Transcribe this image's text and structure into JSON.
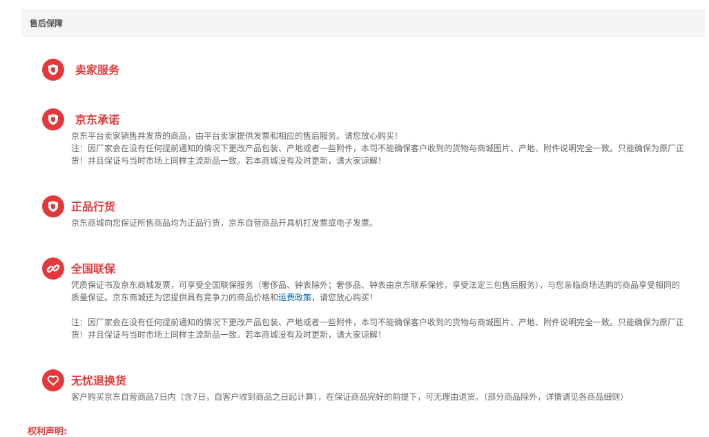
{
  "header": {
    "title": "售后保障"
  },
  "sections": [
    {
      "title": "卖家服务"
    },
    {
      "title": "京东承诺",
      "lines": [
        "京东平台卖家销售并发货的商品，由平台卖家提供发票和相应的售后服务。请您放心购买！",
        "注：因厂家会在没有任何提前通知的情况下更改产品包装、产地或者一些附件，本司不能确保客户收到的货物与商城图片、产地、附件说明完全一致。只能确保为原厂正",
        "货！并且保证与当时市场上同样主流新品一致。若本商城没有及时更新，请大家谅解！"
      ]
    },
    {
      "title": "正品行货",
      "lines": [
        "京东商城向您保证所售商品均为正品行货，京东自营商品开具机打发票或电子发票。"
      ]
    },
    {
      "title": "全国联保",
      "line1": "凭质保证书及京东商城发票，可享受全国联保服务（奢侈品、钟表除外；奢侈品、钟表由京东联系保修，享受法定三包售后服务），与您亲临商场选购的商品享受相同的",
      "line2_before": "质量保证。京东商城还为您提供具有竞争力的商品价格和",
      "link_text": "运费政策",
      "line2_after": "，请您放心购买！",
      "note_lines": [
        "注：因厂家会在没有任何提前通知的情况下更改产品包装、产地或者一些附件，本司不能确保客户收到的货物与商城图片、产地、附件说明完全一致。只能确保为原厂正",
        "货！并且保证与当时市场上同样主流新品一致。若本商城没有及时更新，请大家谅解！"
      ]
    },
    {
      "title": "无忧退换货",
      "lines": [
        "客户购买京东自营商品7日内（含7日，自客户收到商品之日起计算），在保证商品完好的前提下，可无理由退货。（部分商品除外，详情请见各商品细则）"
      ]
    }
  ],
  "footer": {
    "label": "权利声明:"
  },
  "icons": [
    "shield-icon",
    "shield-icon",
    "shield-icon",
    "link-icon",
    "heart-icon"
  ],
  "colors": {
    "accent": "#e4393c",
    "link": "#005ea7",
    "text": "#666666"
  }
}
